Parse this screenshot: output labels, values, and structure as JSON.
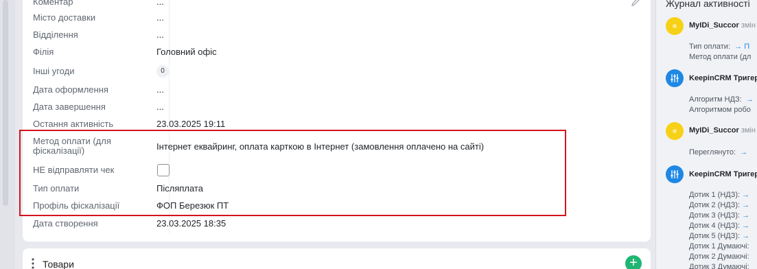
{
  "fields": [
    {
      "label": "Коментар",
      "value": "..."
    },
    {
      "label": "Місто доставки",
      "value": "..."
    },
    {
      "label": "Відділення",
      "value": "..."
    },
    {
      "label": "Філія",
      "value": "Головний офіс"
    },
    {
      "label": "Інші угоди",
      "value": "0"
    },
    {
      "label": "Дата оформлення",
      "value": "..."
    },
    {
      "label": "Дата завершення",
      "value": "..."
    },
    {
      "label": "Остання активність",
      "value": "23.03.2025 19:11"
    },
    {
      "label_line1": "Метод оплати (для",
      "label_line2": "фіскалізації)",
      "value": "Інтернет еквайринг, оплата карткою в Інтернет (замовлення оплачено на сайті)"
    },
    {
      "label": "НЕ відправляти чек",
      "checked": false
    },
    {
      "label": "Тип оплати",
      "value": "Післяплата"
    },
    {
      "label": "Профіль фіскалізації",
      "value": "ФОП Березюк ПТ"
    },
    {
      "label": "Дата створення",
      "value": "23.03.2025 18:35"
    }
  ],
  "goods": {
    "title": "Товари",
    "add_label": "+"
  },
  "activity": {
    "title": "Журнал активності",
    "entries": [
      {
        "user": "MyIDi_Succor",
        "action": "змін",
        "lines": [
          "Тип оплати:",
          "Метод оплати (дл"
        ],
        "arrow": "→ П"
      },
      {
        "user": "KeepinCRM Тригер",
        "action": "",
        "lines": [
          "Алгоритм НДЗ:",
          "Алгоритмом робо"
        ],
        "arrow": "→"
      },
      {
        "user": "MyIDi_Succor",
        "action": "змін",
        "lines": [
          "Переглянуто:"
        ],
        "arrow": "→"
      },
      {
        "user": "KeepinCRM Тригер",
        "action": "",
        "lines": [
          "Дотик 1 (НДЗ):",
          "Дотик 2 (НДЗ):",
          "Дотик 3 (НДЗ):",
          "Дотик 4 (НДЗ):",
          "Дотик 5 (НДЗ):",
          "Дотик 1 Думаючі:",
          "Дотик 2 Думаючі:",
          "Дотик 3 Думаючі:"
        ],
        "arrow": "→"
      }
    ]
  },
  "colors": {
    "highlight": "#d4141b",
    "accent_green": "#21b573",
    "accent_blue": "#1e88e5",
    "avatar_yellow": "#f7d117"
  },
  "icons": {
    "edit": "pencil-icon",
    "goods_menu": "vertical-dots-icon",
    "add": "plus-icon",
    "trigger": "sliders-icon"
  }
}
